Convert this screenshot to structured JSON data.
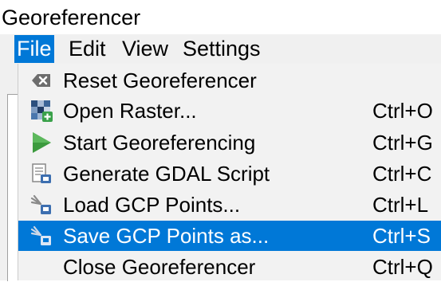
{
  "window": {
    "title": "Georeferencer"
  },
  "menubar": {
    "items": [
      {
        "label": "File",
        "active": true
      },
      {
        "label": "Edit",
        "active": false
      },
      {
        "label": "View",
        "active": false
      },
      {
        "label": "Settings",
        "active": false
      }
    ]
  },
  "file_menu": {
    "items": [
      {
        "label": "Reset Georeferencer",
        "shortcut": "",
        "icon": "reset-icon"
      },
      {
        "label": "Open Raster...",
        "shortcut": "Ctrl+O",
        "icon": "open-raster-icon"
      },
      {
        "label": "Start Georeferencing",
        "shortcut": "Ctrl+G",
        "icon": "play-icon"
      },
      {
        "label": "Generate GDAL Script",
        "shortcut": "Ctrl+C",
        "icon": "gdal-script-icon"
      },
      {
        "label": "Load GCP Points...",
        "shortcut": "Ctrl+L",
        "icon": "load-gcp-icon"
      },
      {
        "label": "Save GCP Points as...",
        "shortcut": "Ctrl+S",
        "icon": "save-gcp-icon",
        "highlighted": true
      },
      {
        "label": "Close Georeferencer",
        "shortcut": "Ctrl+Q",
        "icon": ""
      }
    ]
  },
  "colors": {
    "highlight": "#0078d7",
    "menu_background": "#f2f2f2",
    "menubar_background": "#f0f0f0"
  }
}
